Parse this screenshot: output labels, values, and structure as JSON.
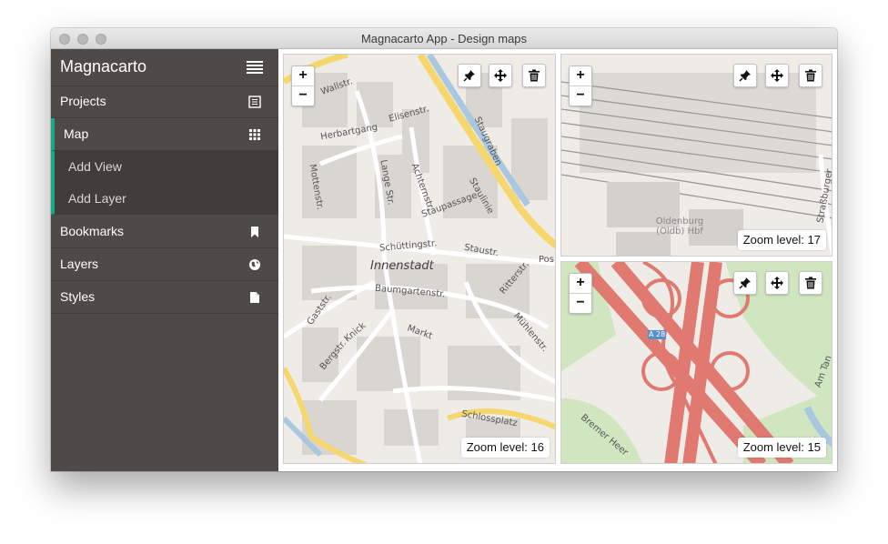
{
  "window": {
    "title": "Magnacarto App - Design maps"
  },
  "sidebar": {
    "brand": "Magnacarto",
    "menu_icon": "hamburger-icon",
    "items": [
      {
        "label": "Projects",
        "icon": "list-icon"
      },
      {
        "label": "Map",
        "icon": "grid-icon",
        "active": true
      },
      {
        "label": "Bookmarks",
        "icon": "bookmark-icon"
      },
      {
        "label": "Layers",
        "icon": "globe-icon"
      },
      {
        "label": "Styles",
        "icon": "file-icon"
      }
    ],
    "subitems": [
      {
        "label": "Add View"
      },
      {
        "label": "Add Layer"
      }
    ],
    "accent_color": "#1aa88c"
  },
  "maps": [
    {
      "zoom_in": "+",
      "zoom_out": "−",
      "zoom_label": "Zoom level:",
      "zoom_value": "16",
      "labels": [
        "Innenstadt",
        "Wallstr.",
        "Herbartgang",
        "Elisenstr.",
        "Staugraben",
        "Lange Str.",
        "Achternstr.",
        "Staupassage",
        "Staulinie",
        "Schüttingstr.",
        "Staustr.",
        "Baumgartenstr.",
        "Ritterstr.",
        "Mühlenstr.",
        "Markt",
        "Gaststr.",
        "Bergstr.",
        "Knick",
        "Schlossplatz",
        "Mottenstr.",
        "Pos"
      ]
    },
    {
      "zoom_in": "+",
      "zoom_out": "−",
      "zoom_label": "Zoom level:",
      "zoom_value": "17",
      "labels": [
        "Oldenburg (Oldb) Hbf",
        "Straßburger"
      ]
    },
    {
      "zoom_in": "+",
      "zoom_out": "−",
      "zoom_label": "Zoom level:",
      "zoom_value": "15",
      "labels": [
        "A 28",
        "Bremer Heer",
        "Am Tan"
      ]
    }
  ],
  "toolbar_icons": [
    "pin-icon",
    "move-icon",
    "trash-icon"
  ]
}
